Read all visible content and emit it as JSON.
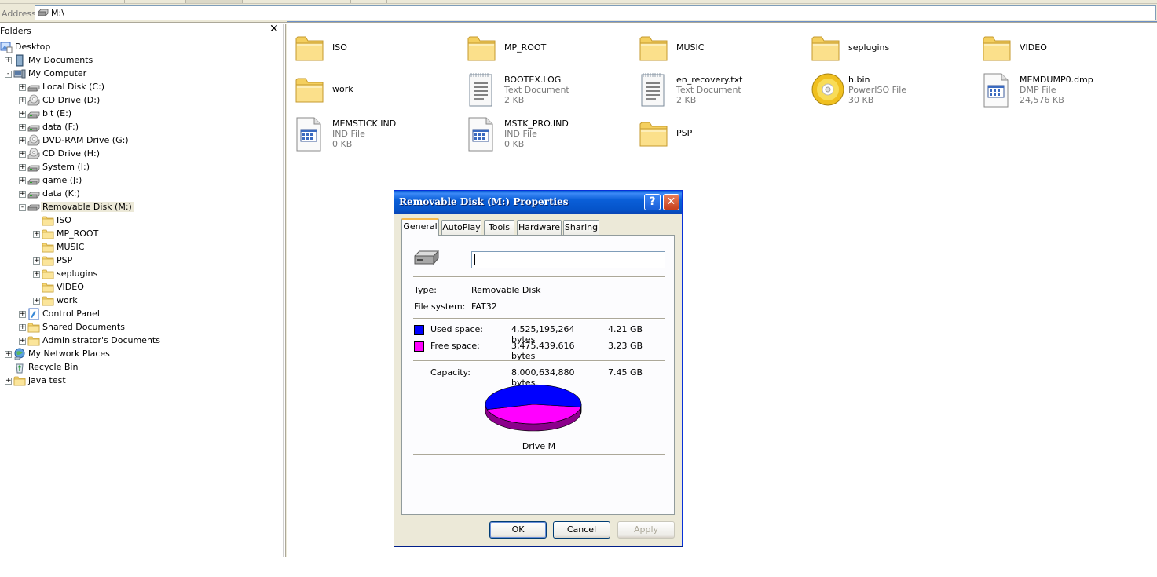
{
  "address": {
    "label": "Address",
    "path": "M:\\"
  },
  "folders_pane": {
    "title": "Folders",
    "close": "✕",
    "tree": [
      {
        "label": "Desktop",
        "icon": "desktop-icon",
        "level": 0,
        "exp": ""
      },
      {
        "label": "My Documents",
        "icon": "my-documents-icon",
        "level": 1,
        "exp": "+"
      },
      {
        "label": "My Computer",
        "icon": "my-computer-icon",
        "level": 1,
        "exp": "-"
      },
      {
        "label": "Local Disk (C:)",
        "icon": "hard-drive-icon",
        "level": 2,
        "exp": "+"
      },
      {
        "label": "CD Drive (D:)",
        "icon": "cd-drive-icon",
        "level": 2,
        "exp": "+"
      },
      {
        "label": "bit (E:)",
        "icon": "hard-drive-icon",
        "level": 2,
        "exp": "+"
      },
      {
        "label": "data (F:)",
        "icon": "hard-drive-icon",
        "level": 2,
        "exp": "+"
      },
      {
        "label": "DVD-RAM Drive (G:)",
        "icon": "cd-drive-icon",
        "level": 2,
        "exp": "+"
      },
      {
        "label": "CD Drive (H:)",
        "icon": "cd-drive-icon",
        "level": 2,
        "exp": "+"
      },
      {
        "label": "System (I:)",
        "icon": "hard-drive-icon",
        "level": 2,
        "exp": "+"
      },
      {
        "label": "game (J:)",
        "icon": "hard-drive-icon",
        "level": 2,
        "exp": "+"
      },
      {
        "label": "data (K:)",
        "icon": "hard-drive-icon",
        "level": 2,
        "exp": "+"
      },
      {
        "label": "Removable Disk (M:)",
        "icon": "removable-disk-icon",
        "level": 2,
        "exp": "-",
        "selected": true
      },
      {
        "label": "ISO",
        "icon": "folder-icon",
        "level": 3,
        "exp": ""
      },
      {
        "label": "MP_ROOT",
        "icon": "folder-icon",
        "level": 3,
        "exp": "+"
      },
      {
        "label": "MUSIC",
        "icon": "folder-icon",
        "level": 3,
        "exp": ""
      },
      {
        "label": "PSP",
        "icon": "folder-icon",
        "level": 3,
        "exp": "+"
      },
      {
        "label": "seplugins",
        "icon": "folder-icon",
        "level": 3,
        "exp": "+"
      },
      {
        "label": "VIDEO",
        "icon": "folder-icon",
        "level": 3,
        "exp": ""
      },
      {
        "label": "work",
        "icon": "folder-icon",
        "level": 3,
        "exp": "+"
      },
      {
        "label": "Control Panel",
        "icon": "control-panel-icon",
        "level": 2,
        "exp": "+"
      },
      {
        "label": "Shared Documents",
        "icon": "folder-icon",
        "level": 2,
        "exp": "+"
      },
      {
        "label": "Administrator's Documents",
        "icon": "folder-icon",
        "level": 2,
        "exp": "+"
      },
      {
        "label": "My Network Places",
        "icon": "network-places-icon",
        "level": 1,
        "exp": "+"
      },
      {
        "label": "Recycle Bin",
        "icon": "recycle-bin-icon",
        "level": 1,
        "exp": ""
      },
      {
        "label": "java test",
        "icon": "folder-icon",
        "level": 1,
        "exp": "+"
      }
    ]
  },
  "files": [
    {
      "name": "ISO",
      "icon": "folder-icon"
    },
    {
      "name": "MP_ROOT",
      "icon": "folder-icon"
    },
    {
      "name": "MUSIC",
      "icon": "folder-icon"
    },
    {
      "name": "seplugins",
      "icon": "folder-icon"
    },
    {
      "name": "VIDEO",
      "icon": "folder-icon"
    },
    {
      "name": "work",
      "icon": "folder-icon"
    },
    {
      "name": "BOOTEX.LOG",
      "type": "Text Document",
      "size": "2 KB",
      "icon": "text-document-icon"
    },
    {
      "name": "en_recovery.txt",
      "type": "Text Document",
      "size": "2 KB",
      "icon": "text-document-icon"
    },
    {
      "name": "h.bin",
      "type": "PowerISO File",
      "size": "30 KB",
      "icon": "disc-image-icon"
    },
    {
      "name": "MEMDUMP0.dmp",
      "type": "DMP File",
      "size": "24,576 KB",
      "icon": "generic-file-icon"
    },
    {
      "name": "MEMSTICK.IND",
      "type": "IND File",
      "size": "0 KB",
      "icon": "generic-file-icon"
    },
    {
      "name": "MSTK_PRO.IND",
      "type": "IND File",
      "size": "0 KB",
      "icon": "generic-file-icon"
    },
    {
      "name": "PSP",
      "icon": "folder-icon"
    }
  ],
  "dialog": {
    "title": "Removable Disk (M:) Properties",
    "help": "?",
    "close": "✕",
    "tabs": [
      "General",
      "AutoPlay",
      "Tools",
      "Hardware",
      "Sharing"
    ],
    "active_tab": "General",
    "label_value": "",
    "type_label": "Type:",
    "type_value": "Removable Disk",
    "fs_label": "File system:",
    "fs_value": "FAT32",
    "used": {
      "label": "Used space:",
      "bytes": "4,525,195,264 bytes",
      "gb": "4.21 GB",
      "color": "#0000ff"
    },
    "free": {
      "label": "Free space:",
      "bytes": "3,475,439,616 bytes",
      "gb": "3.23 GB",
      "color": "#ff00ff"
    },
    "capacity": {
      "label": "Capacity:",
      "bytes": "8,000,634,880 bytes",
      "gb": "7.45 GB"
    },
    "pie_caption": "Drive M",
    "used_fraction": 0.5656,
    "buttons": {
      "ok": "OK",
      "cancel": "Cancel",
      "apply": "Apply"
    }
  }
}
